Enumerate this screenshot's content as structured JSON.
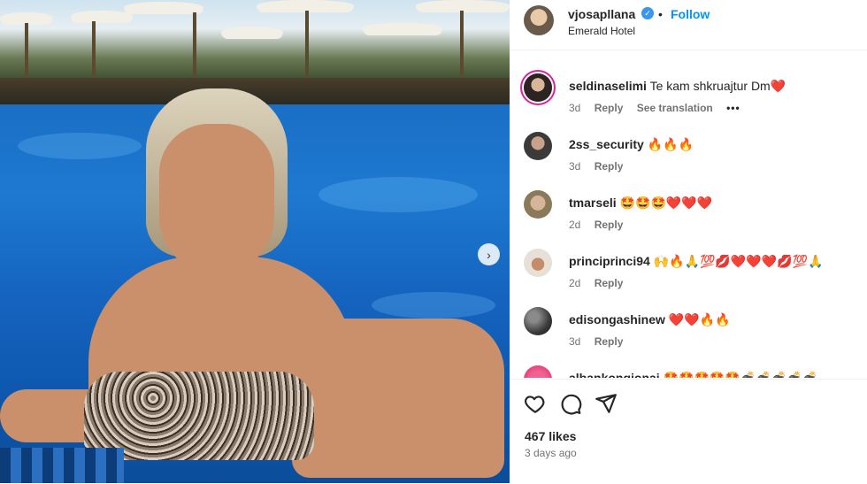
{
  "post": {
    "author": "vjosapllana",
    "separator": "•",
    "follow_label": "Follow",
    "location": "Emerald Hotel",
    "verified_icon": "verified-badge-icon",
    "carousel_next_glyph": "›"
  },
  "comments": [
    {
      "user": "seldinaselimi",
      "text": "Te kam shkruajtur Dm❤️",
      "age": "3d",
      "reply": "Reply",
      "see_translation": "See translation",
      "more": "•••"
    },
    {
      "user": "2ss_security",
      "text": "🔥🔥🔥",
      "age": "3d",
      "reply": "Reply"
    },
    {
      "user": "tmarseli",
      "text": "🤩🤩🤩❤️❤️❤️",
      "age": "2d",
      "reply": "Reply"
    },
    {
      "user": "principrinci94",
      "text": "🙌🔥🙏💯💋❤️❤️❤️💋💯🙏",
      "age": "2d",
      "reply": "Reply"
    },
    {
      "user": "edisongashinew",
      "text": "❤️❤️🔥🔥",
      "age": "3d",
      "reply": "Reply"
    },
    {
      "user": "albankongjonaj",
      "text": "🤩🤩🤩🤩🤩💣💣💣💣💣",
      "age": "",
      "reply": ""
    }
  ],
  "footer": {
    "likes": "467 likes",
    "ago": "3 days ago"
  },
  "colors": {
    "accent": "#0095f6",
    "story_ring": "#d6249f",
    "muted": "#737373"
  }
}
